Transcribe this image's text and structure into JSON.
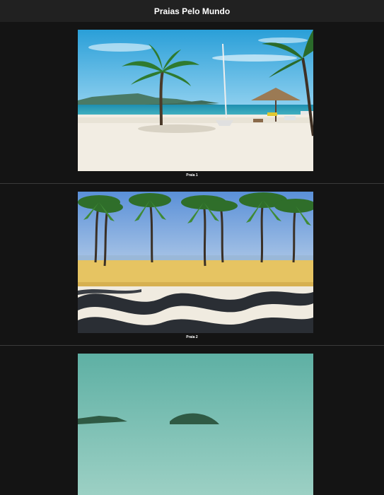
{
  "header": {
    "title": "Praias Pelo Mundo"
  },
  "gallery": {
    "items": [
      {
        "caption": "Praia 1",
        "image": "tropical beach with palm trees and thatched umbrella"
      },
      {
        "caption": "Praia 2",
        "image": "copacabana promenade wave pattern with palm trees"
      },
      {
        "caption": "",
        "image": "beach with mountain under teal sky"
      }
    ]
  }
}
